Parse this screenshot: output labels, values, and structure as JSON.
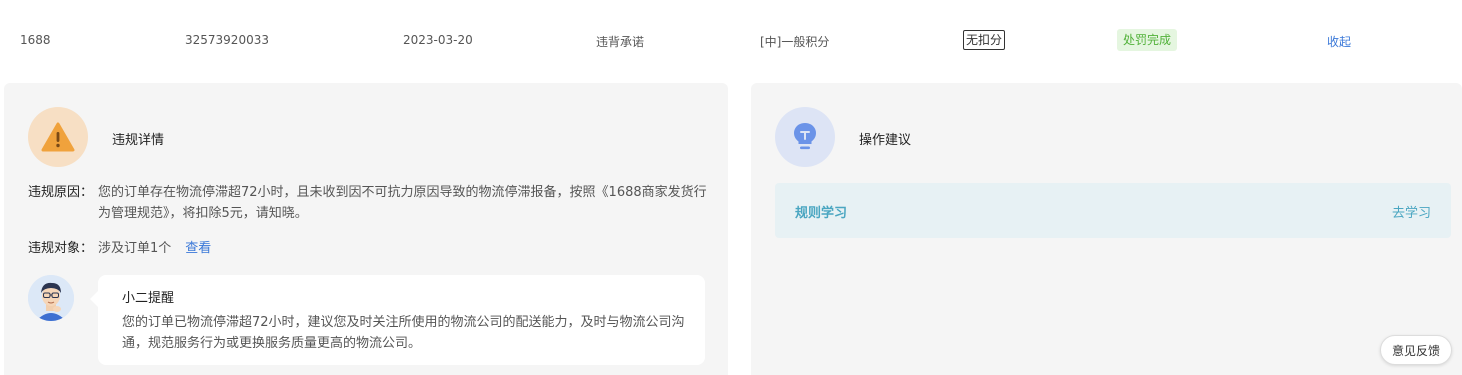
{
  "record": {
    "platform": "1688",
    "order_id": "32573920033",
    "date": "2023-03-20",
    "violation_type": "违背承诺",
    "category": "[中]一般积分",
    "deduction": "无扣分",
    "status": "处罚完成",
    "collapse": "收起"
  },
  "details": {
    "title": "违规详情",
    "reason_label": "违规原因：",
    "reason_text": "您的订单存在物流停滞超72小时，且未收到因不可抗力原因导致的物流停滞报备，按照《1688商家发货行为管理规范》，将扣除5元，请知晓。",
    "target_label": "违规对象：",
    "target_text": "涉及订单1个",
    "target_link": "查看",
    "reminder_title": "小二提醒",
    "reminder_text": "您的订单已物流停滞超72小时，建议您及时关注所使用的物流公司的配送能力，及时与物流公司沟通，规范服务行为或更换服务质量更高的物流公司。"
  },
  "suggestions": {
    "title": "操作建议",
    "rule_title": "规则学习",
    "rule_link": "去学习"
  },
  "feedback": "意见反馈",
  "colors": {
    "link": "#3a78d8",
    "status_bg": "#e5f6e0",
    "status_text": "#52b23a",
    "warn_bg": "#f7dfc4",
    "warn_icon": "#f0a23c",
    "bulb_bg": "#dde4f5",
    "bulb_icon": "#6b93e8",
    "rule_text": "#4aa6c1"
  },
  "icons": {
    "warning": "warning-icon",
    "bulb": "lightbulb-icon",
    "avatar": "avatar"
  }
}
